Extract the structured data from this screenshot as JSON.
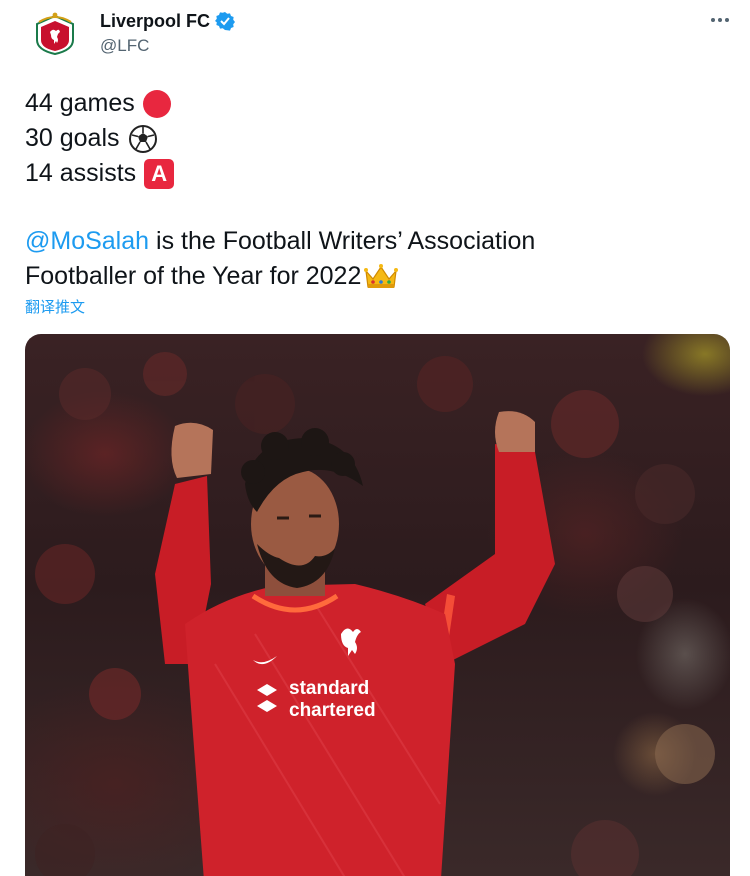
{
  "account": {
    "name": "Liverpool FC",
    "handle": "@LFC",
    "verified": true,
    "avatar_icon": "liverbird-crest-icon"
  },
  "tweet": {
    "stats": [
      {
        "text": "44 games",
        "emoji": "red-circle-icon"
      },
      {
        "text": "30 goals",
        "emoji": "soccer-ball-icon"
      },
      {
        "text": "14 assists",
        "emoji": "letter-a-icon"
      }
    ],
    "mention": "@MoSalah",
    "sentence_rest_line1": " is the Football Writers’ Association",
    "sentence_line2": "Footballer of the Year for 2022",
    "trailing_emoji": "crown-icon",
    "translate_label": "翻译推文",
    "emoji_a_letter": "A"
  },
  "photo": {
    "sponsor_line1": "standard",
    "sponsor_line2": "chartered"
  },
  "colors": {
    "link": "#1d9bf0",
    "text": "#0f1419",
    "secondary": "#536471",
    "lfc_red": "#c8102e"
  }
}
